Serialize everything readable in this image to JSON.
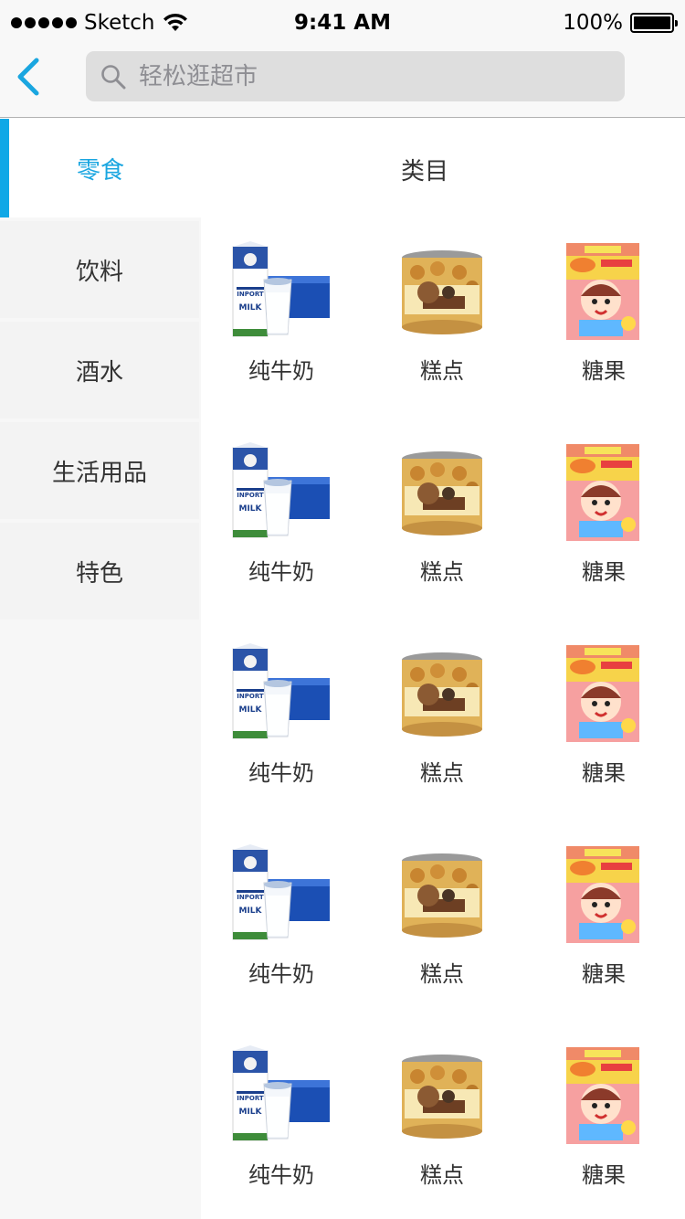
{
  "status_bar": {
    "carrier": "Sketch",
    "time": "9:41 AM",
    "battery": "100%",
    "battery_level": 1.0
  },
  "nav": {
    "search_placeholder": "轻松逛超市"
  },
  "sidebar": {
    "items": [
      {
        "label": "零食",
        "active": true
      },
      {
        "label": "饮料",
        "active": false
      },
      {
        "label": "酒水",
        "active": false
      },
      {
        "label": "生活用品",
        "active": false
      },
      {
        "label": "特色",
        "active": false
      }
    ]
  },
  "content": {
    "title": "类目",
    "rows": [
      {
        "items": [
          {
            "label": "纯牛奶",
            "icon": "milk-icon"
          },
          {
            "label": "糕点",
            "icon": "pastry-jar-icon"
          },
          {
            "label": "糖果",
            "icon": "candy-bag-icon"
          }
        ]
      },
      {
        "items": [
          {
            "label": "纯牛奶",
            "icon": "milk-icon"
          },
          {
            "label": "糕点",
            "icon": "pastry-jar-icon"
          },
          {
            "label": "糖果",
            "icon": "candy-bag-icon"
          }
        ]
      },
      {
        "items": [
          {
            "label": "纯牛奶",
            "icon": "milk-icon"
          },
          {
            "label": "糕点",
            "icon": "pastry-jar-icon"
          },
          {
            "label": "糖果",
            "icon": "candy-bag-icon"
          }
        ]
      },
      {
        "items": [
          {
            "label": "纯牛奶",
            "icon": "milk-icon"
          },
          {
            "label": "糕点",
            "icon": "pastry-jar-icon"
          },
          {
            "label": "糖果",
            "icon": "candy-bag-icon"
          }
        ]
      },
      {
        "items": [
          {
            "label": "纯牛奶",
            "icon": "milk-icon"
          },
          {
            "label": "糕点",
            "icon": "pastry-jar-icon"
          },
          {
            "label": "糖果",
            "icon": "candy-bag-icon"
          }
        ]
      }
    ],
    "product_milk_label": "MILK",
    "product_milk_brand": "INPORT"
  },
  "colors": {
    "accent": "#1aa6e0",
    "sidebar_bg": "#f3f3f3",
    "nav_bg": "#f8f8f8",
    "search_bg": "#dedede"
  }
}
